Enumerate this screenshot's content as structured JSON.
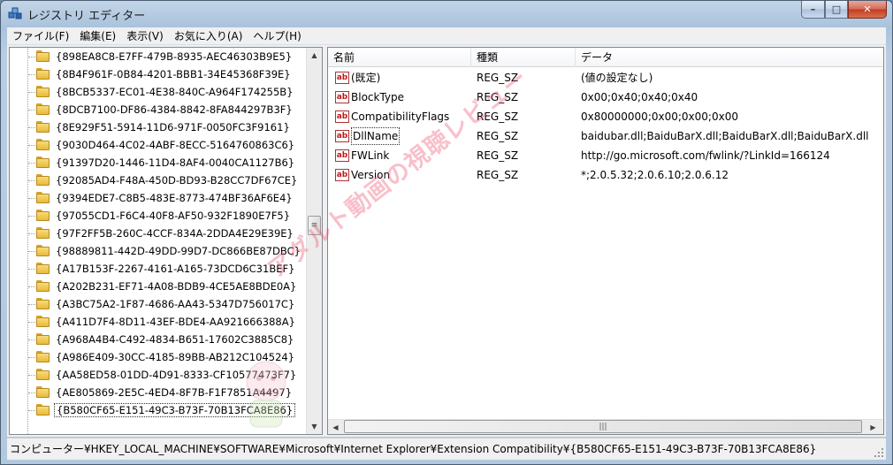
{
  "window": {
    "title": "レジストリ エディター",
    "controls": {
      "minimize": "–",
      "maximize": "□",
      "close": "✕"
    }
  },
  "menubar": {
    "items": [
      {
        "label": "ファイル(F)"
      },
      {
        "label": "編集(E)"
      },
      {
        "label": "表示(V)"
      },
      {
        "label": "お気に入り(A)"
      },
      {
        "label": "ヘルプ(H)"
      }
    ]
  },
  "tree": {
    "items": [
      {
        "label": "{898EA8C8-E7FF-479B-8935-AEC46303B9E5}"
      },
      {
        "label": "{8B4F961F-0B84-4201-BBB1-34E45368F39E}"
      },
      {
        "label": "{8BCB5337-EC01-4E38-840C-A964F174255B}"
      },
      {
        "label": "{8DCB7100-DF86-4384-8842-8FA844297B3F}"
      },
      {
        "label": "{8E929F51-5914-11D6-971F-0050FC3F9161}"
      },
      {
        "label": "{9030D464-4C02-4ABF-8ECC-5164760863C6}"
      },
      {
        "label": "{91397D20-1446-11D4-8AF4-0040CA1127B6}"
      },
      {
        "label": "{92085AD4-F48A-450D-BD93-B28CC7DF67CE}"
      },
      {
        "label": "{9394EDE7-C8B5-483E-8773-474BF36AF6E4}"
      },
      {
        "label": "{97055CD1-F6C4-40F8-AF50-932F1890E7F5}"
      },
      {
        "label": "{97F2FF5B-260C-4CCF-834A-2DDA4E29E39E}"
      },
      {
        "label": "{98889811-442D-49DD-99D7-DC866BE87DBC}"
      },
      {
        "label": "{A17B153F-2267-4161-A165-73DCD6C31BEF}"
      },
      {
        "label": "{A202B231-EF71-4A08-BDB9-4CE5AE8BDE0A}"
      },
      {
        "label": "{A3BC75A2-1F87-4686-AA43-5347D756017C}"
      },
      {
        "label": "{A411D7F4-8D11-43EF-BDE4-AA921666388A}"
      },
      {
        "label": "{A968A4B4-C492-4834-B651-17602C3885C8}"
      },
      {
        "label": "{A986E409-30CC-4185-89BB-AB212C104524}"
      },
      {
        "label": "{AA58ED58-01DD-4D91-8333-CF10577473F7}"
      },
      {
        "label": "{AE805869-2E5C-4ED4-8F7B-F1F7851A4497}"
      },
      {
        "label": "{B580CF65-E151-49C3-B73F-70B13FCA8E86}",
        "selected": true
      }
    ]
  },
  "list": {
    "columns": [
      "名前",
      "種類",
      "データ"
    ],
    "rows": [
      {
        "name": "(既定)",
        "type": "REG_SZ",
        "data": "(値の設定なし)"
      },
      {
        "name": "BlockType",
        "type": "REG_SZ",
        "data": "0x00;0x40;0x40;0x40"
      },
      {
        "name": "CompatibilityFlags",
        "type": "REG_SZ",
        "data": "0x80000000;0x00;0x00;0x00"
      },
      {
        "name": "DllName",
        "type": "REG_SZ",
        "data": "baidubar.dll;BaiduBarX.dll;BaiduBarX.dll;BaiduBarX.dll",
        "focused": true
      },
      {
        "name": "FWLink",
        "type": "REG_SZ",
        "data": "http://go.microsoft.com/fwlink/?LinkId=166124"
      },
      {
        "name": "Version",
        "type": "REG_SZ",
        "data": "*;2.0.5.32;2.0.6.10;2.0.6.12"
      }
    ],
    "value_icon_glyph": "ab"
  },
  "statusbar": {
    "path": "コンピューター¥HKEY_LOCAL_MACHINE¥SOFTWARE¥Microsoft¥Internet Explorer¥Extension Compatibility¥{B580CF65-E151-49C3-B73F-70B13FCA8E86}"
  },
  "watermark": {
    "text": "アダルト動画の視聴レビュー"
  },
  "colors": {
    "accent_icon": "#c01616",
    "folder": "#e9b93b",
    "title_bg": "#b9cde2"
  }
}
